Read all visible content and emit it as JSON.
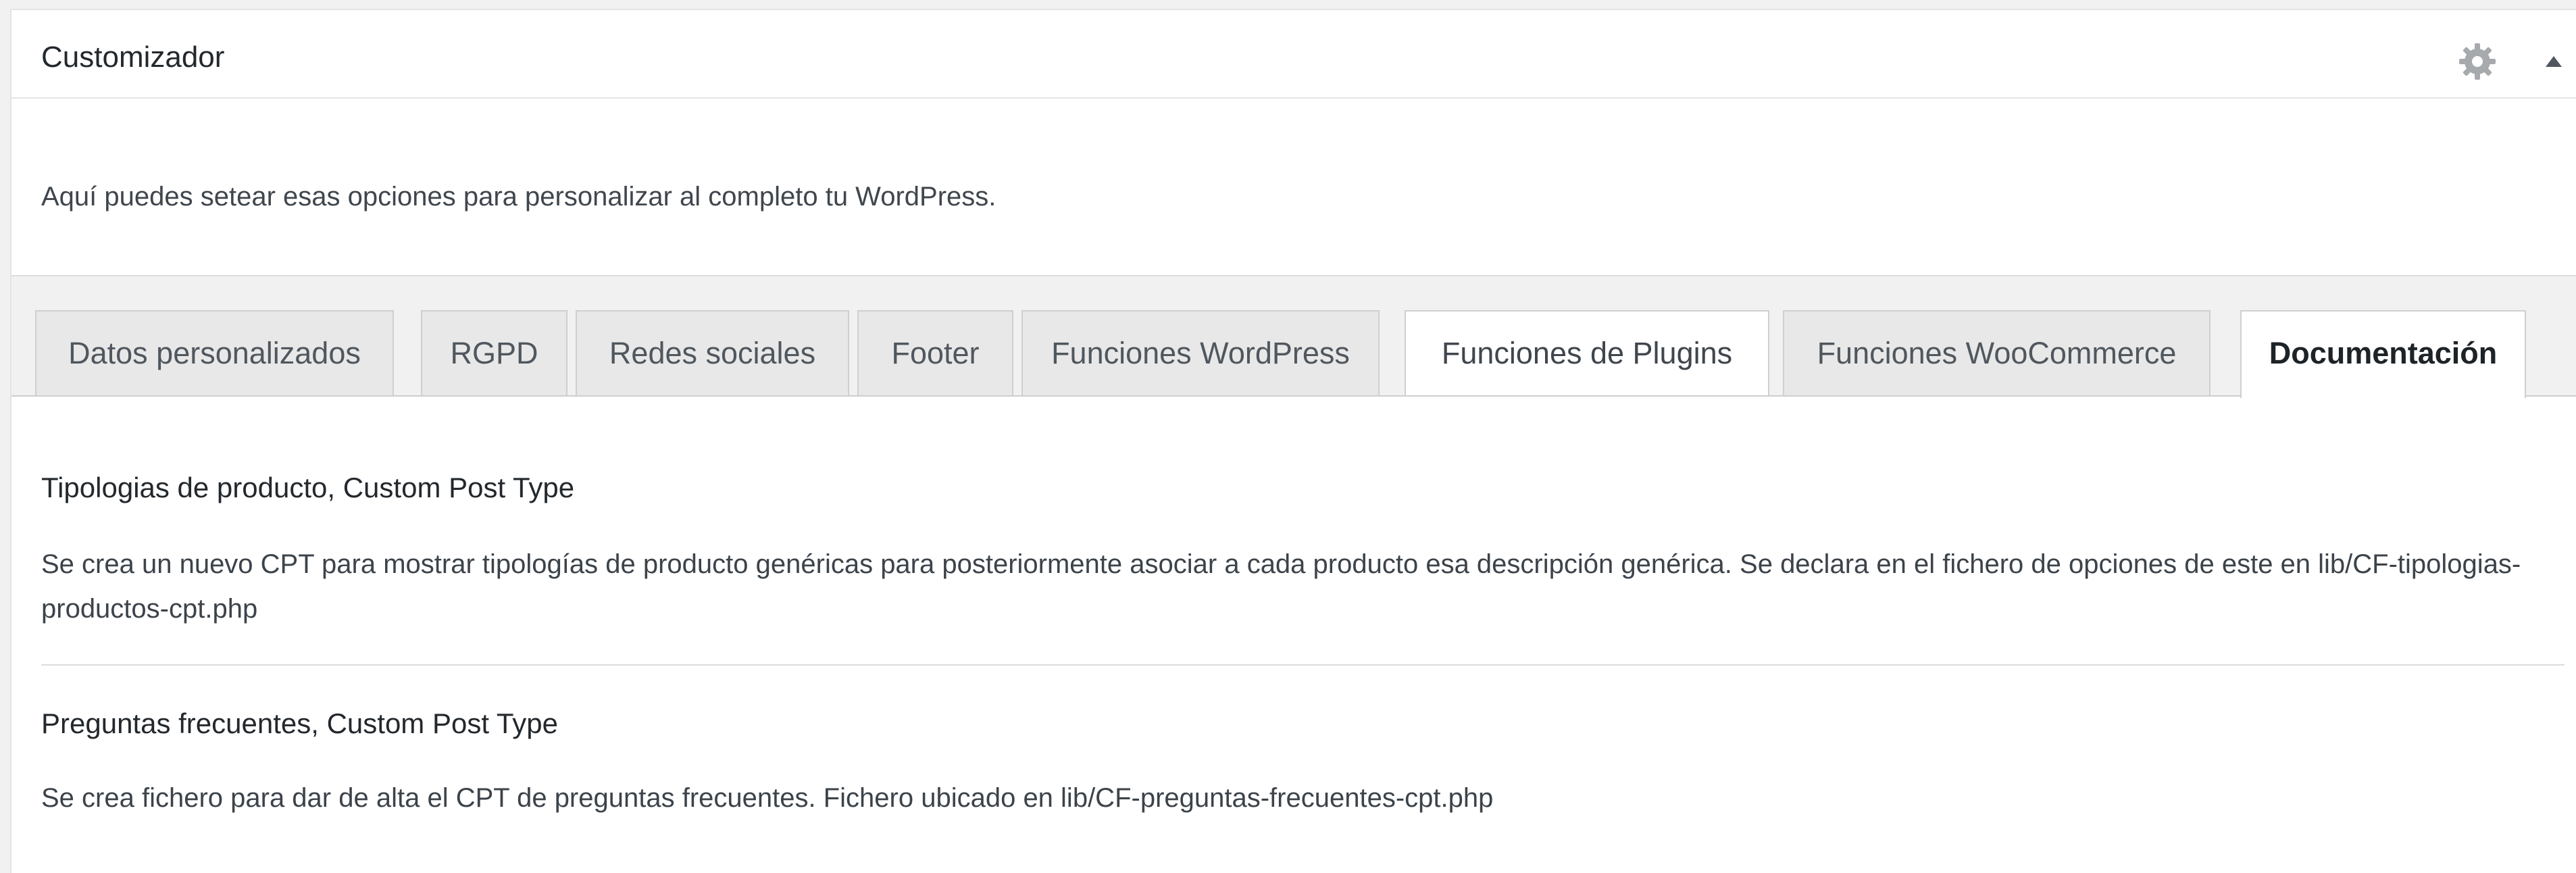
{
  "panel": {
    "title": "Customizador",
    "description": "Aquí puedes setear esas opciones para personalizar al completo tu WordPress.",
    "icons": {
      "settings": "gear-icon",
      "collapse": "triangle-up-icon"
    },
    "accent_color": "#1d2327"
  },
  "tabs": [
    {
      "label": "Datos personalizados"
    },
    {
      "label": "RGPD"
    },
    {
      "label": "Redes sociales"
    },
    {
      "label": "Footer"
    },
    {
      "label": "Funciones WordPress"
    },
    {
      "label": "Funciones de Plugins"
    },
    {
      "label": "Funciones WooCommerce"
    },
    {
      "label": "Documentación"
    }
  ],
  "active_tab": "Documentación",
  "sections": [
    {
      "title": "Tipologias de producto, Custom Post Type",
      "text": "Se crea un nuevo CPT para mostrar tipologías de producto genéricas para posteriormente asociar a cada producto esa descripción genérica. Se declara en el fichero de opciones de este en lib/CF-tipologias-productos-cpt.php"
    },
    {
      "title": "Preguntas frecuentes, Custom Post Type",
      "text": "Se crea fichero para dar de alta el CPT de preguntas frecuentes. Fichero ubicado en lib/CF-preguntas-frecuentes-cpt.php"
    }
  ]
}
